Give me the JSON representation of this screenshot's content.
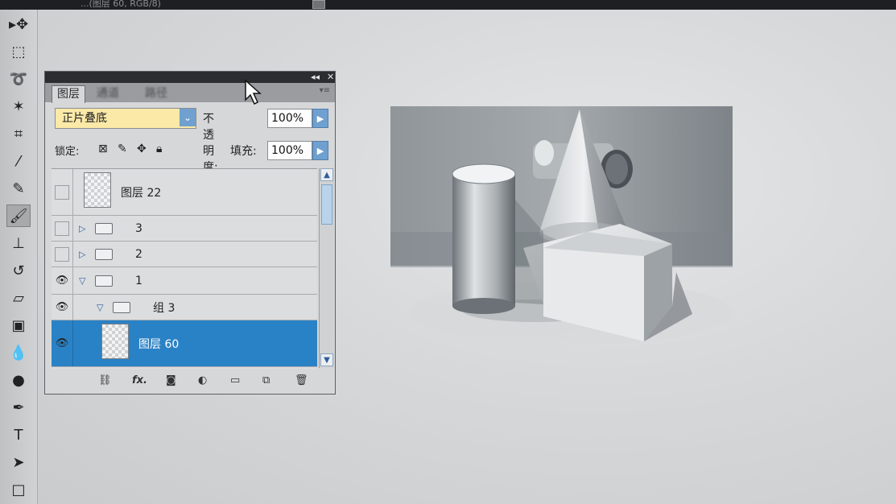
{
  "window": {
    "title": "...(图层 60, RGB/8)"
  },
  "toolbar": {
    "tools": [
      {
        "name": "move-tool",
        "glyph": "▸✥"
      },
      {
        "name": "marquee-tool",
        "glyph": "⬚"
      },
      {
        "name": "lasso-tool",
        "glyph": "➰"
      },
      {
        "name": "magic-wand-tool",
        "glyph": "✶"
      },
      {
        "name": "crop-tool",
        "glyph": "⌗"
      },
      {
        "name": "eyedropper-tool",
        "glyph": "⁄"
      },
      {
        "name": "healing-brush-tool",
        "glyph": "✎"
      },
      {
        "name": "brush-tool",
        "glyph": "🖌"
      },
      {
        "name": "clone-stamp-tool",
        "glyph": "⊥"
      },
      {
        "name": "history-brush-tool",
        "glyph": "↺"
      },
      {
        "name": "eraser-tool",
        "glyph": "▱"
      },
      {
        "name": "gradient-tool",
        "glyph": "▣"
      },
      {
        "name": "blur-tool",
        "glyph": "💧"
      },
      {
        "name": "dodge-tool",
        "glyph": "●"
      },
      {
        "name": "pen-tool",
        "glyph": "✒"
      },
      {
        "name": "type-tool",
        "glyph": "T"
      },
      {
        "name": "path-selection-tool",
        "glyph": "➤"
      },
      {
        "name": "shape-tool",
        "glyph": "□"
      }
    ],
    "active_tool": "brush-tool"
  },
  "layers_panel": {
    "tabs": [
      "图层",
      "通道",
      "路径"
    ],
    "active_tab": "图层",
    "header_buttons": {
      "collapse": "◂◂",
      "close": "✕"
    },
    "menu_glyph": "▾≡",
    "blend_mode": "正片叠底",
    "opacity_label": "不透明度:",
    "opacity_value": "100%",
    "lock_label": "锁定:",
    "fill_label": "填充:",
    "fill_value": "100%",
    "layers": [
      {
        "name": "图层 22",
        "type": "layer",
        "visible": false,
        "selected": false,
        "indent": 0
      },
      {
        "name": "3",
        "type": "group",
        "visible": false,
        "expanded": false,
        "indent": 0
      },
      {
        "name": "2",
        "type": "group",
        "visible": false,
        "expanded": false,
        "indent": 0
      },
      {
        "name": "1",
        "type": "group",
        "visible": true,
        "expanded": true,
        "indent": 0
      },
      {
        "name": "组 3",
        "type": "group",
        "visible": true,
        "expanded": true,
        "indent": 1
      },
      {
        "name": "图层 60",
        "type": "layer",
        "visible": true,
        "selected": true,
        "indent": 1
      }
    ],
    "footer_icons": [
      "link-icon",
      "fx-icon",
      "mask-icon",
      "adjustment-icon",
      "group-icon",
      "new-layer-icon",
      "trash-icon"
    ],
    "footer_fx_label": "fx."
  },
  "colors": {
    "selection_blue": "#2a82c6",
    "blend_field_yellow": "#fbe9a8",
    "panel_bg": "#d6d7d8"
  }
}
